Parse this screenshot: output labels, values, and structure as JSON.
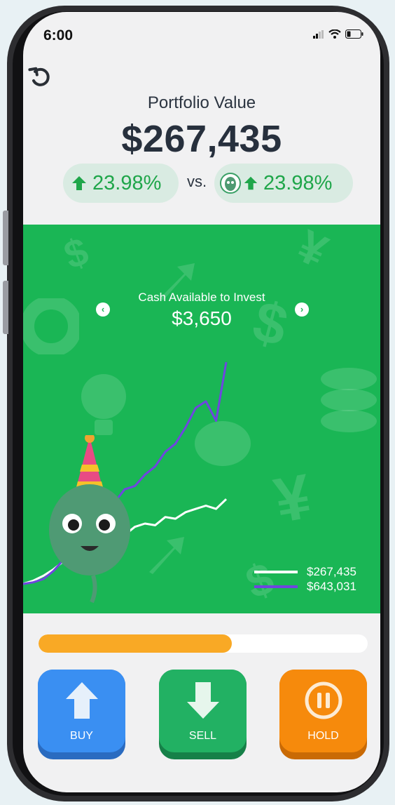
{
  "status_bar": {
    "time": "6:00"
  },
  "portfolio": {
    "label": "Portfolio Value",
    "value": "$267,435",
    "user_change": "23.98%",
    "vs_label": "vs.",
    "benchmark_change": "23.98%"
  },
  "cash": {
    "label": "Cash Available to Invest",
    "value": "$3,650"
  },
  "chart_data": {
    "type": "line",
    "series": [
      {
        "color": "#ffffff",
        "values": [
          0,
          2,
          5,
          9,
          14,
          20,
          26,
          29,
          31,
          33,
          30,
          35,
          37,
          36,
          41,
          40,
          44,
          46,
          48,
          46,
          52
        ]
      },
      {
        "color": "#6f45e0",
        "values": [
          0,
          1,
          3,
          8,
          15,
          24,
          32,
          40,
          46,
          50,
          58,
          60,
          67,
          72,
          81,
          86,
          96,
          108,
          112,
          100,
          136
        ]
      }
    ],
    "legend": [
      {
        "label": "$267,435",
        "color": "#ffffff"
      },
      {
        "label": "$643,031",
        "color": "#6f45e0"
      }
    ]
  },
  "progress": {
    "fraction": 0.588,
    "color": "#f9a925"
  },
  "actions": [
    {
      "label": "BUY",
      "color": "#3a8ff2",
      "shadow": "#2a6bc0",
      "icon": "up-arrow-icon"
    },
    {
      "label": "SELL",
      "color": "#22b163",
      "shadow": "#168048",
      "icon": "down-arrow-icon"
    },
    {
      "label": "HOLD",
      "color": "#f68a0c",
      "shadow": "#c96a05",
      "icon": "pause-icon"
    }
  ]
}
